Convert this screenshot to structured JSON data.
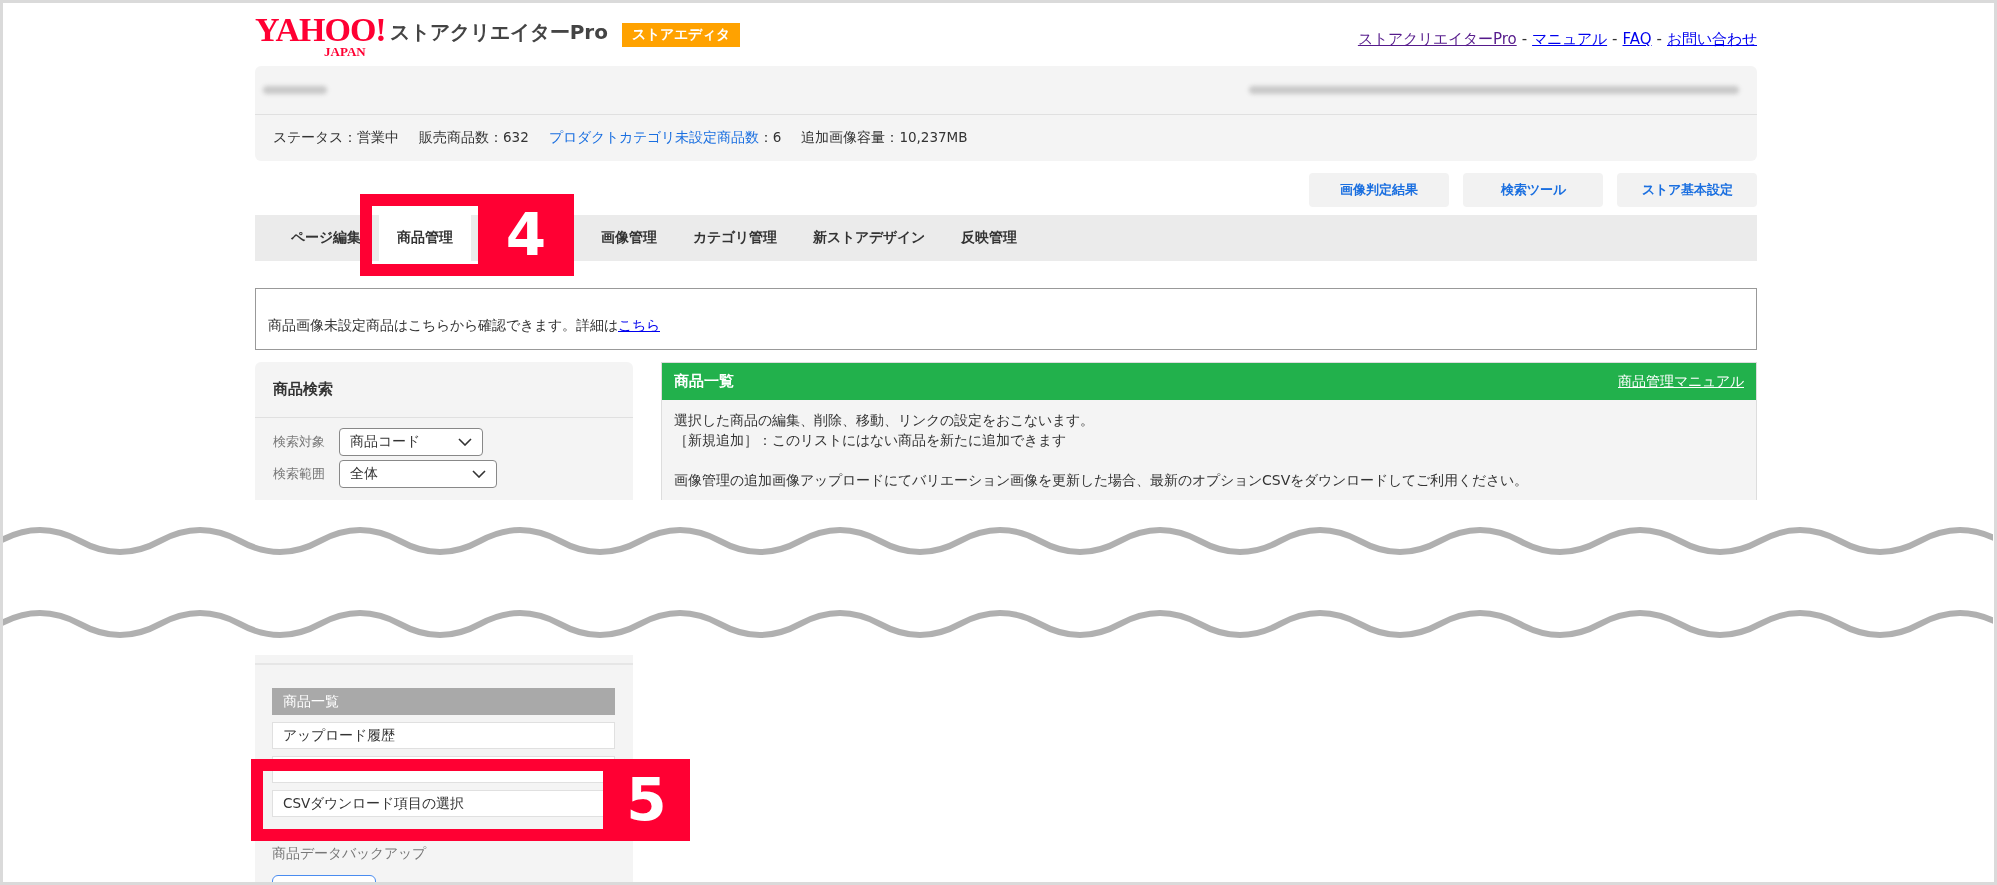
{
  "header": {
    "logo_main": "YAHOO!",
    "logo_sub": "JAPAN",
    "product": "ストアクリエイターPro",
    "badge": "ストアエディタ",
    "links": [
      {
        "label": "ストアクリエイターPro",
        "visited": true
      },
      {
        "label": "マニュアル",
        "visited": false
      },
      {
        "label": "FAQ",
        "visited": false
      },
      {
        "label": "お問い合わせ",
        "visited": false
      }
    ],
    "separator": "-"
  },
  "status": [
    {
      "kind": "text",
      "label": "ステータス：営業中"
    },
    {
      "kind": "text",
      "label": "販売商品数：632"
    },
    {
      "kind": "link",
      "label": "プロダクトカテゴリ未設定商品数",
      "value": "：6"
    },
    {
      "kind": "text",
      "label": "追加画像容量：10,237MB"
    }
  ],
  "tool_buttons": [
    "画像判定結果",
    "検索ツール",
    "ストア基本設定"
  ],
  "tabs": [
    {
      "label": "ページ編集",
      "selected": false
    },
    {
      "label": "商品管理",
      "selected": true
    },
    {
      "label": "画像管理",
      "selected": false
    },
    {
      "label": "カテゴリ管理",
      "selected": false
    },
    {
      "label": "新ストアデザイン",
      "selected": false
    },
    {
      "label": "反映管理",
      "selected": false
    }
  ],
  "notice": {
    "text": "商品画像未設定商品はこちらから確認できます。詳細は",
    "link": "こちら"
  },
  "search_panel": {
    "title": "商品検索",
    "fields": [
      {
        "label": "検索対象",
        "value": "商品コード"
      },
      {
        "label": "検索範囲",
        "value": "全体"
      }
    ]
  },
  "list_panel": {
    "title": "商品一覧",
    "manual_link": "商品管理マニュアル",
    "paragraphs": [
      [
        "選択した商品の編集、削除、移動、リンクの設定をおこないます。",
        "［新規追加］：このリストにはない商品を新たに追加できます"
      ],
      [
        "画像管理の追加画像アップロードにてバリエーション画像を更新した場合、最新のオプションCSVをダウンロードしてご利用ください。"
      ]
    ]
  },
  "side_menu": {
    "items": [
      {
        "label": "商品一覧",
        "selected": true
      },
      {
        "label": "アップロード履歴",
        "selected": false
      },
      {
        "selected": false
      },
      {
        "label": "CSVダウンロード項目の選択",
        "selected": false
      }
    ],
    "section_label": "商品データバックアップ"
  },
  "callouts": [
    {
      "number": "4"
    },
    {
      "number": "5"
    }
  ]
}
